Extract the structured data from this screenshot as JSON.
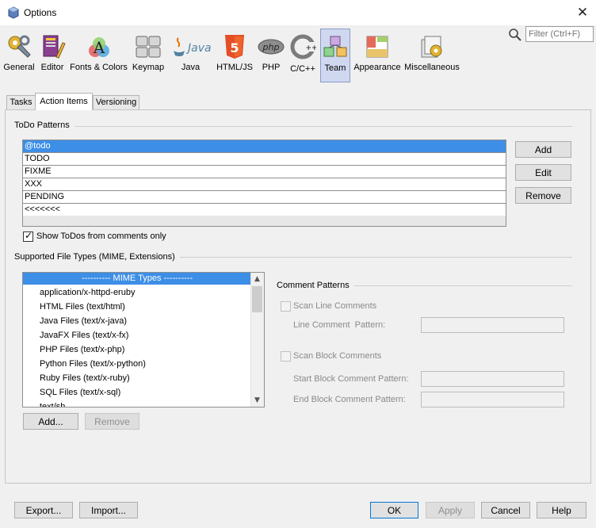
{
  "window": {
    "title": "Options",
    "close_glyph": "✕"
  },
  "categories": [
    {
      "label": "General",
      "icon": "general-icon"
    },
    {
      "label": "Editor",
      "icon": "editor-icon"
    },
    {
      "label": "Fonts & Colors",
      "icon": "fonts-colors-icon"
    },
    {
      "label": "Keymap",
      "icon": "keymap-icon"
    },
    {
      "label": "Java",
      "icon": "java-icon"
    },
    {
      "label": "HTML/JS",
      "icon": "html5-icon"
    },
    {
      "label": "PHP",
      "icon": "php-icon"
    },
    {
      "label": "C/C++",
      "icon": "cpp-icon"
    },
    {
      "label": "Team",
      "icon": "team-icon",
      "selected": true
    },
    {
      "label": "Appearance",
      "icon": "appearance-icon"
    },
    {
      "label": "Miscellaneous",
      "icon": "miscellaneous-icon"
    }
  ],
  "filter": {
    "placeholder": "Filter (Ctrl+F)",
    "icon": "search-icon"
  },
  "tabs": [
    {
      "label": "Tasks"
    },
    {
      "label": "Action Items",
      "active": true
    },
    {
      "label": "Versioning"
    }
  ],
  "todo": {
    "section_title": "ToDo Patterns",
    "patterns": [
      "@todo",
      "TODO",
      "FIXME",
      "XXX",
      "PENDING",
      "<<<<<<<"
    ],
    "selected_index": 0,
    "add_label": "Add",
    "edit_label": "Edit",
    "remove_label": "Remove",
    "show_todos_label": "Show ToDos from comments only",
    "show_todos_checked": true
  },
  "file_types": {
    "section_title": "Supported File Types (MIME, Extensions)",
    "items": [
      "---------- MIME Types ----------",
      "application/x-httpd-eruby",
      "HTML Files (text/html)",
      "Java Files (text/x-java)",
      "JavaFX Files (text/x-fx)",
      "PHP Files (text/x-php)",
      "Python Files (text/x-python)",
      "Ruby Files (text/x-ruby)",
      "SQL Files (text/x-sql)",
      "text/sh"
    ],
    "selected_index": 0,
    "add_label": "Add...",
    "remove_label": "Remove"
  },
  "comment_patterns": {
    "section_title": "Comment Patterns",
    "scan_line_label": "Scan Line Comments",
    "line_pattern_label": "Line Comment  Pattern:",
    "scan_block_label": "Scan Block Comments",
    "start_block_label": "Start Block Comment Pattern:",
    "end_block_label": "End Block Comment Pattern:",
    "line_pattern_value": "",
    "start_block_value": "",
    "end_block_value": ""
  },
  "footer": {
    "export_label": "Export...",
    "import_label": "Import...",
    "ok_label": "OK",
    "apply_label": "Apply",
    "cancel_label": "Cancel",
    "help_label": "Help"
  },
  "colors": {
    "selection": "#3d8ee6",
    "category_selected_bg": "#cfd8ef",
    "accent_border": "#0078d7"
  }
}
